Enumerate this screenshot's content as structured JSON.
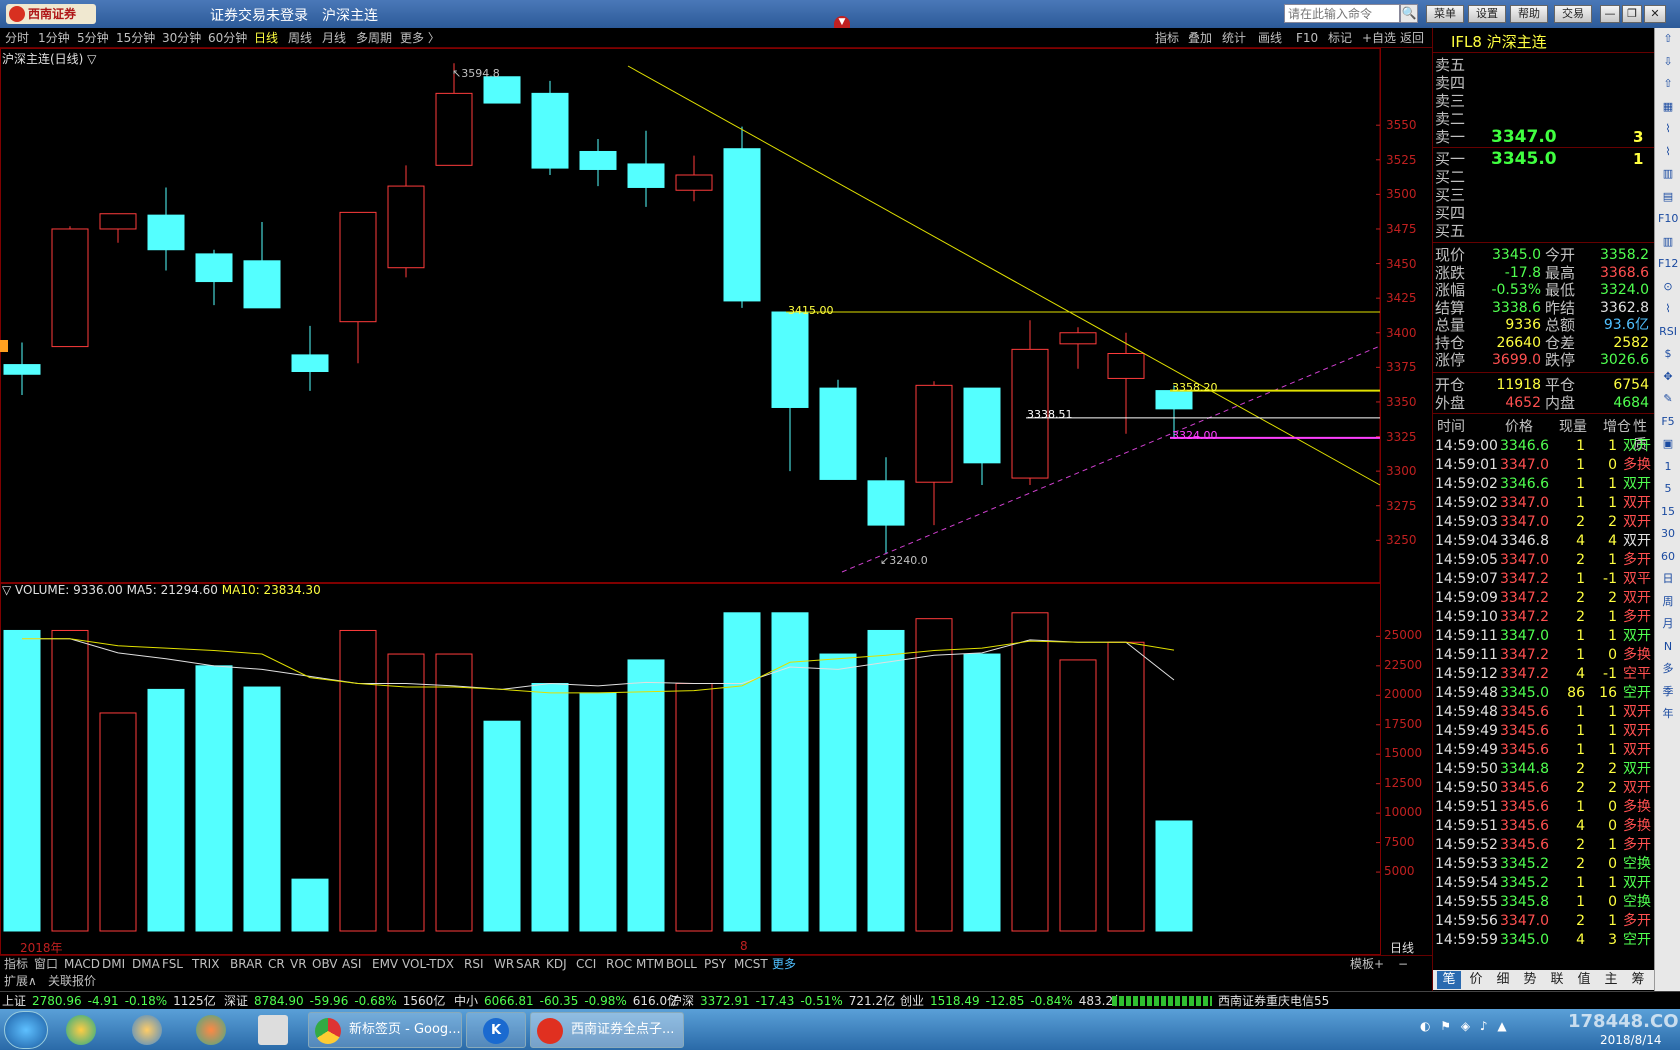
{
  "window": {
    "logo_text": "西南证券",
    "status_text": "证券交易未登录",
    "instrument_title": "沪深主连",
    "cmd_placeholder": "请在此输入命令",
    "buttons": [
      "菜单",
      "设置",
      "帮助",
      "交易"
    ]
  },
  "periods": [
    "分时",
    "1分钟",
    "5分钟",
    "15分钟",
    "30分钟",
    "60分钟",
    "日线",
    "周线",
    "月线",
    "多周期",
    "更多 〉"
  ],
  "active_period": "日线",
  "toolbar_right": [
    "指标",
    "叠加",
    "统计",
    "画线",
    "F10",
    "标记",
    "+自选",
    "返回"
  ],
  "kchart": {
    "title": "沪深主连(日线) ▽",
    "y_ticks": [
      "3550",
      "3525",
      "3500",
      "3475",
      "3450",
      "3425",
      "3400",
      "3375",
      "3350",
      "3325",
      "3300",
      "3275",
      "3250"
    ],
    "annotations": {
      "high": "3594.8",
      "low": "3240.0",
      "line1": "3415.00",
      "line2": "3358.20",
      "line3": "3338.51",
      "line4": "3324.00"
    }
  },
  "volume": {
    "label_main": "▽ VOLUME: 9336.00",
    "label_ma5": "MA5: 21294.60",
    "label_ma10": "MA10: 23834.30",
    "y_ticks": [
      "25000",
      "22500",
      "20000",
      "17500",
      "15000",
      "12500",
      "10000",
      "7500",
      "5000"
    ],
    "x_year": "2018年",
    "x_month": "8",
    "period_label": "日线"
  },
  "chart_data": {
    "type": "candlestick",
    "ylim": [
      3230,
      3600
    ],
    "candles": [
      {
        "o": 3377,
        "h": 3393,
        "l": 3355,
        "c": 3370
      },
      {
        "o": 3390,
        "h": 3477,
        "l": 3390,
        "c": 3475
      },
      {
        "o": 3475,
        "h": 3485,
        "l": 3465,
        "c": 3486
      },
      {
        "o": 3485,
        "h": 3505,
        "l": 3445,
        "c": 3460
      },
      {
        "o": 3457,
        "h": 3460,
        "l": 3420,
        "c": 3437
      },
      {
        "o": 3452,
        "h": 3480,
        "l": 3418,
        "c": 3418
      },
      {
        "o": 3384,
        "h": 3405,
        "l": 3358,
        "c": 3372
      },
      {
        "o": 3408,
        "h": 3484,
        "l": 3378,
        "c": 3487
      },
      {
        "o": 3447,
        "h": 3521,
        "l": 3440,
        "c": 3506
      },
      {
        "o": 3521,
        "h": 3594.8,
        "l": 3521,
        "c": 3573
      },
      {
        "o": 3585,
        "h": 3585,
        "l": 3566,
        "c": 3566
      },
      {
        "o": 3573,
        "h": 3582,
        "l": 3514,
        "c": 3519
      },
      {
        "o": 3531,
        "h": 3540,
        "l": 3506,
        "c": 3518
      },
      {
        "o": 3522,
        "h": 3546,
        "l": 3491,
        "c": 3505
      },
      {
        "o": 3503,
        "h": 3528,
        "l": 3495,
        "c": 3514
      },
      {
        "o": 3533,
        "h": 3549,
        "l": 3418,
        "c": 3423
      },
      {
        "o": 3415,
        "h": 3415,
        "l": 3300,
        "c": 3346
      },
      {
        "o": 3360,
        "h": 3366,
        "l": 3300,
        "c": 3294
      },
      {
        "o": 3293,
        "h": 3310,
        "l": 3240,
        "c": 3261
      },
      {
        "o": 3292,
        "h": 3365,
        "l": 3261,
        "c": 3362
      },
      {
        "o": 3360,
        "h": 3360,
        "l": 3290,
        "c": 3306
      },
      {
        "o": 3295,
        "h": 3409,
        "l": 3290,
        "c": 3388
      },
      {
        "o": 3392,
        "h": 3404,
        "l": 3374,
        "c": 3400
      },
      {
        "o": 3367,
        "h": 3400,
        "l": 3327,
        "c": 3385
      },
      {
        "o": 3358.2,
        "h": 3362,
        "l": 3324,
        "c": 3345
      }
    ],
    "volume": [
      25500,
      25500,
      18500,
      20500,
      22500,
      20700,
      4400,
      25500,
      23500,
      23500,
      17800,
      21000,
      20200,
      23000,
      21000,
      27000,
      27000,
      23500,
      25500,
      26500,
      23500,
      27000,
      23000,
      24500,
      9336
    ],
    "ma5": [
      24800,
      24800,
      23600,
      23100,
      22500,
      22200,
      21600,
      21000,
      21000,
      20800,
      20500,
      21000,
      20800,
      21100,
      21000,
      21000,
      22400,
      22200,
      22800,
      23400,
      23600,
      24700,
      24500,
      24500,
      21294.6
    ],
    "ma10": [
      24800,
      24800,
      24200,
      24000,
      23800,
      23500,
      21500,
      21000,
      20700,
      20700,
      20500,
      20200,
      20200,
      20300,
      20400,
      20800,
      22800,
      23100,
      23400,
      23800,
      24000,
      24600,
      24500,
      24500,
      23834.3
    ]
  },
  "indicator_tabs": [
    "指标",
    "窗口",
    "MACD",
    "DMI",
    "DMA",
    "FSL",
    "TRIX",
    "BRAR",
    "CR",
    "VR",
    "OBV",
    "ASI",
    "EMV",
    "VOL-TDX",
    "RSI",
    "WR",
    "SAR",
    "KDJ",
    "CCI",
    "ROC",
    "MTM",
    "BOLL",
    "PSY",
    "MCST",
    "更多"
  ],
  "indicator_right": [
    "模板",
    "+",
    "−"
  ],
  "ext_tabs": [
    "扩展∧",
    "关联报价"
  ],
  "quote": {
    "code": "IFL8",
    "name": "沪深主连",
    "sell": [
      {
        "label": "卖五",
        "price": "",
        "vol": ""
      },
      {
        "label": "卖四",
        "price": "",
        "vol": ""
      },
      {
        "label": "卖三",
        "price": "",
        "vol": ""
      },
      {
        "label": "卖二",
        "price": "",
        "vol": ""
      },
      {
        "label": "卖一",
        "price": "3347.0",
        "vol": "3"
      }
    ],
    "buy": [
      {
        "label": "买一",
        "price": "3345.0",
        "vol": "1"
      },
      {
        "label": "买二",
        "price": "",
        "vol": ""
      },
      {
        "label": "买三",
        "price": "",
        "vol": ""
      },
      {
        "label": "买四",
        "price": "",
        "vol": ""
      },
      {
        "label": "买五",
        "price": "",
        "vol": ""
      }
    ],
    "stats": [
      {
        "l1": "现价",
        "v1": "3345.0",
        "c1": "dn",
        "l2": "今开",
        "v2": "3358.2",
        "c2": "dn"
      },
      {
        "l1": "涨跌",
        "v1": "-17.8",
        "c1": "dn",
        "l2": "最高",
        "v2": "3368.6",
        "c2": "up"
      },
      {
        "l1": "涨幅",
        "v1": "-0.53%",
        "c1": "dn",
        "l2": "最低",
        "v2": "3324.0",
        "c2": "dn"
      },
      {
        "l1": "结算",
        "v1": "3338.6",
        "c1": "dn",
        "l2": "昨结",
        "v2": "3362.8",
        "c2": "wh"
      },
      {
        "l1": "总量",
        "v1": "9336",
        "c1": "yl",
        "l2": "总额",
        "v2": "93.6亿",
        "c2": "cy"
      },
      {
        "l1": "持仓",
        "v1": "26640",
        "c1": "yl",
        "l2": "仓差",
        "v2": "2582",
        "c2": "yl"
      },
      {
        "l1": "涨停",
        "v1": "3699.0",
        "c1": "up",
        "l2": "跌停",
        "v2": "3026.6",
        "c2": "dn"
      }
    ],
    "stats2": [
      {
        "l1": "开仓",
        "v1": "11918",
        "c1": "yl",
        "l2": "平仓",
        "v2": "6754",
        "c2": "yl"
      },
      {
        "l1": "外盘",
        "v1": "4652",
        "c1": "up",
        "l2": "内盘",
        "v2": "4684",
        "c2": "dn"
      }
    ],
    "tick_headers": [
      "时间",
      "价格",
      "现量",
      "增仓",
      "性质"
    ],
    "ticks": [
      {
        "t": "14:59:00",
        "p": "3346.6",
        "v": "1",
        "d": "1",
        "n": "双开",
        "c": "dn"
      },
      {
        "t": "14:59:01",
        "p": "3347.0",
        "v": "1",
        "d": "0",
        "n": "多换",
        "c": "up"
      },
      {
        "t": "14:59:02",
        "p": "3346.6",
        "v": "1",
        "d": "1",
        "n": "双开",
        "c": "dn"
      },
      {
        "t": "14:59:02",
        "p": "3347.0",
        "v": "1",
        "d": "1",
        "n": "双开",
        "c": "up"
      },
      {
        "t": "14:59:03",
        "p": "3347.0",
        "v": "2",
        "d": "2",
        "n": "双开",
        "c": "up"
      },
      {
        "t": "14:59:04",
        "p": "3346.8",
        "v": "4",
        "d": "4",
        "n": "双开",
        "c": "wh"
      },
      {
        "t": "14:59:05",
        "p": "3347.0",
        "v": "2",
        "d": "1",
        "n": "多开",
        "c": "up"
      },
      {
        "t": "14:59:07",
        "p": "3347.2",
        "v": "1",
        "d": "-1",
        "n": "双平",
        "c": "up"
      },
      {
        "t": "14:59:09",
        "p": "3347.2",
        "v": "2",
        "d": "2",
        "n": "双开",
        "c": "up"
      },
      {
        "t": "14:59:10",
        "p": "3347.2",
        "v": "2",
        "d": "1",
        "n": "多开",
        "c": "up"
      },
      {
        "t": "14:59:11",
        "p": "3347.0",
        "v": "1",
        "d": "1",
        "n": "双开",
        "c": "dn"
      },
      {
        "t": "14:59:11",
        "p": "3347.2",
        "v": "1",
        "d": "0",
        "n": "多换",
        "c": "up"
      },
      {
        "t": "14:59:12",
        "p": "3347.2",
        "v": "4",
        "d": "-1",
        "n": "空平",
        "c": "up"
      },
      {
        "t": "14:59:48",
        "p": "3345.0",
        "v": "86",
        "d": "16",
        "n": "空开",
        "c": "dn"
      },
      {
        "t": "14:59:48",
        "p": "3345.6",
        "v": "1",
        "d": "1",
        "n": "双开",
        "c": "up"
      },
      {
        "t": "14:59:49",
        "p": "3345.6",
        "v": "1",
        "d": "1",
        "n": "双开",
        "c": "up"
      },
      {
        "t": "14:59:49",
        "p": "3345.6",
        "v": "1",
        "d": "1",
        "n": "双开",
        "c": "up"
      },
      {
        "t": "14:59:50",
        "p": "3344.8",
        "v": "2",
        "d": "2",
        "n": "双开",
        "c": "dn"
      },
      {
        "t": "14:59:50",
        "p": "3345.6",
        "v": "2",
        "d": "2",
        "n": "双开",
        "c": "up"
      },
      {
        "t": "14:59:51",
        "p": "3345.6",
        "v": "1",
        "d": "0",
        "n": "多换",
        "c": "up"
      },
      {
        "t": "14:59:51",
        "p": "3345.6",
        "v": "4",
        "d": "0",
        "n": "多换",
        "c": "up"
      },
      {
        "t": "14:59:52",
        "p": "3345.6",
        "v": "2",
        "d": "1",
        "n": "多开",
        "c": "up"
      },
      {
        "t": "14:59:53",
        "p": "3345.2",
        "v": "2",
        "d": "0",
        "n": "空换",
        "c": "dn"
      },
      {
        "t": "14:59:54",
        "p": "3345.2",
        "v": "1",
        "d": "1",
        "n": "双开",
        "c": "dn"
      },
      {
        "t": "14:59:55",
        "p": "3345.8",
        "v": "1",
        "d": "0",
        "n": "空换",
        "c": "dn"
      },
      {
        "t": "14:59:56",
        "p": "3347.0",
        "v": "2",
        "d": "1",
        "n": "多开",
        "c": "up"
      },
      {
        "t": "14:59:59",
        "p": "3345.0",
        "v": "4",
        "d": "3",
        "n": "空开",
        "c": "dn"
      }
    ],
    "bottom_tabs": [
      "笔",
      "价",
      "细",
      "势",
      "联",
      "值",
      "主",
      "筹"
    ]
  },
  "side_icons": [
    "⇧",
    "⇩",
    "⇧",
    "▦",
    "⌇",
    "⌇",
    "▥",
    "▤",
    "F10",
    "▥",
    "F12",
    "⊙",
    "⌇",
    "RSI",
    "$",
    "✥",
    "✎",
    "F5",
    "▣",
    "1",
    "5",
    "15",
    "30",
    "60",
    "日",
    "周",
    "月",
    "N",
    "多",
    "季",
    "年"
  ],
  "status": {
    "items": [
      {
        "name": "上证",
        "val": "2780.96",
        "chg": "-4.91",
        "pct": "-0.18%",
        "amt": "1125亿"
      },
      {
        "name": "深证",
        "val": "8784.90",
        "chg": "-59.96",
        "pct": "-0.68%",
        "amt": "1560亿"
      },
      {
        "name": "中小",
        "val": "6066.81",
        "chg": "-60.35",
        "pct": "-0.98%",
        "amt": "616.0亿"
      },
      {
        "name": "沪深",
        "val": "3372.91",
        "chg": "-17.43",
        "pct": "-0.51%",
        "amt": "721.2亿"
      },
      {
        "name": "创业",
        "val": "1518.49",
        "chg": "-12.85",
        "pct": "-0.84%",
        "amt": "483.2亿"
      }
    ],
    "broker": "西南证券重庆电信55"
  },
  "taskbar": {
    "tasks": [
      "新标签页 - Goog...",
      "",
      "西南证券全点子..."
    ],
    "date": "2018/8/14",
    "watermark": "178448.COM"
  }
}
